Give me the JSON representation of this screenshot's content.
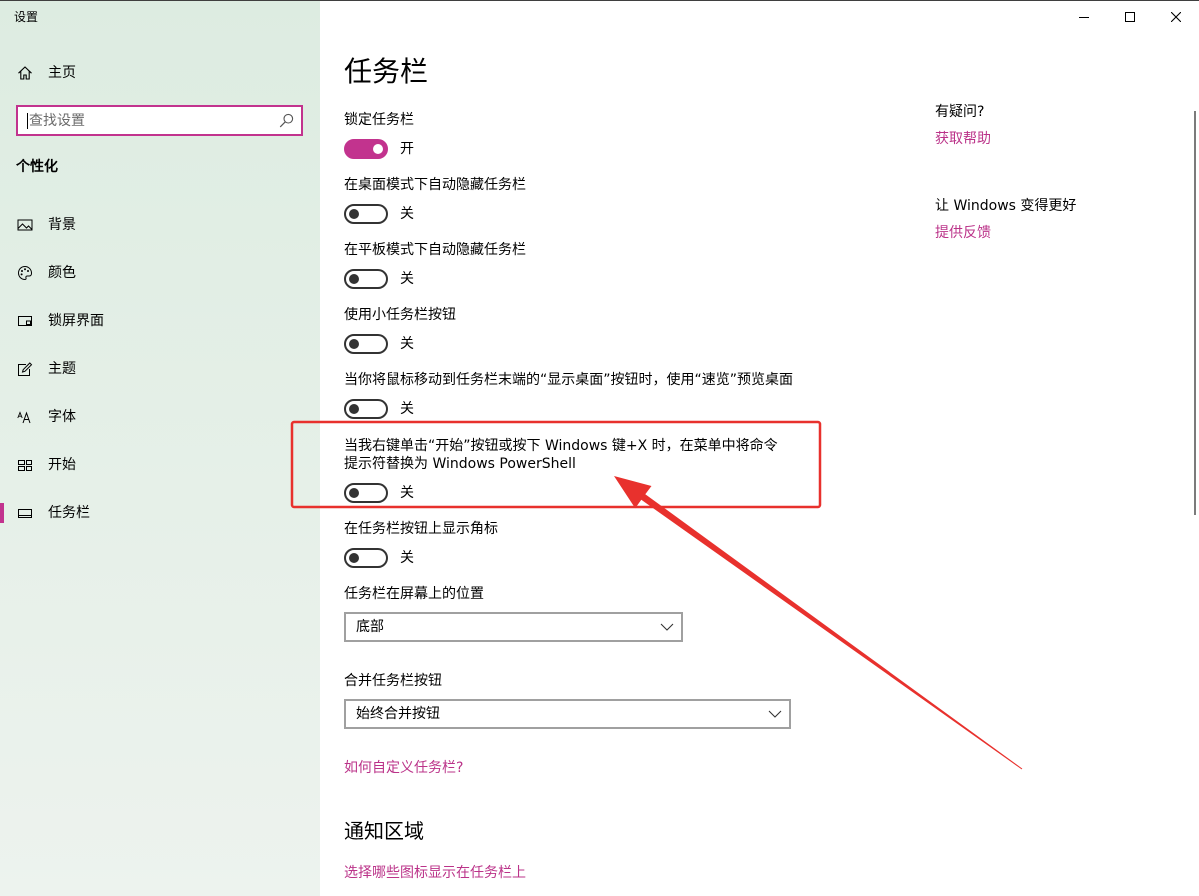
{
  "window": {
    "title": "设置",
    "control_icons": [
      "minimize-icon",
      "maximize-icon",
      "close-icon"
    ]
  },
  "colors": {
    "accent": "#c2338e",
    "link": "#bb3389",
    "annotation": "#e8312d",
    "sidebar_top": "#ddece1",
    "sidebar_bottom": "#edf3ee"
  },
  "sidebar": {
    "home": {
      "label": "主页",
      "icon": "home-icon"
    },
    "search": {
      "placeholder": "查找设置",
      "value": "",
      "icon": "search-icon"
    },
    "section_label": "个性化",
    "items": [
      {
        "label": "背景",
        "icon": "picture-icon",
        "selected": false
      },
      {
        "label": "颜色",
        "icon": "palette-icon",
        "selected": false
      },
      {
        "label": "锁屏界面",
        "icon": "lock-screen-icon",
        "selected": false
      },
      {
        "label": "主题",
        "icon": "theme-icon",
        "selected": false
      },
      {
        "label": "字体",
        "icon": "font-icon",
        "selected": false
      },
      {
        "label": "开始",
        "icon": "start-icon",
        "selected": false
      },
      {
        "label": "任务栏",
        "icon": "taskbar-icon",
        "selected": true
      }
    ]
  },
  "main": {
    "title": "任务栏",
    "toggles": [
      {
        "label": "锁定任务栏",
        "on": true,
        "state_label": "开"
      },
      {
        "label": "在桌面模式下自动隐藏任务栏",
        "on": false,
        "state_label": "关"
      },
      {
        "label": "在平板模式下自动隐藏任务栏",
        "on": false,
        "state_label": "关"
      },
      {
        "label": "使用小任务栏按钮",
        "on": false,
        "state_label": "关"
      },
      {
        "label": "当你将鼠标移动到任务栏末端的“显示桌面”按钮时，使用“速览”预览桌面",
        "on": false,
        "state_label": "关"
      },
      {
        "label": "当我右键单击“开始”按钮或按下 Windows 键+X 时，在菜单中将命令提示符替换为 Windows PowerShell",
        "on": false,
        "state_label": "关",
        "highlighted": true
      },
      {
        "label": "在任务栏按钮上显示角标",
        "on": false,
        "state_label": "关"
      }
    ],
    "position": {
      "label": "任务栏在屏幕上的位置",
      "value": "底部"
    },
    "combine": {
      "label": "合并任务栏按钮",
      "value": "始终合并按钮"
    },
    "customize_link": "如何自定义任务栏?",
    "notification_area": {
      "heading": "通知区域",
      "link": "选择哪些图标显示在任务栏上"
    }
  },
  "aside": {
    "question_heading": "有疑问?",
    "help_link": "获取帮助",
    "improve_heading": "让 Windows 变得更好",
    "feedback_link": "提供反馈"
  }
}
